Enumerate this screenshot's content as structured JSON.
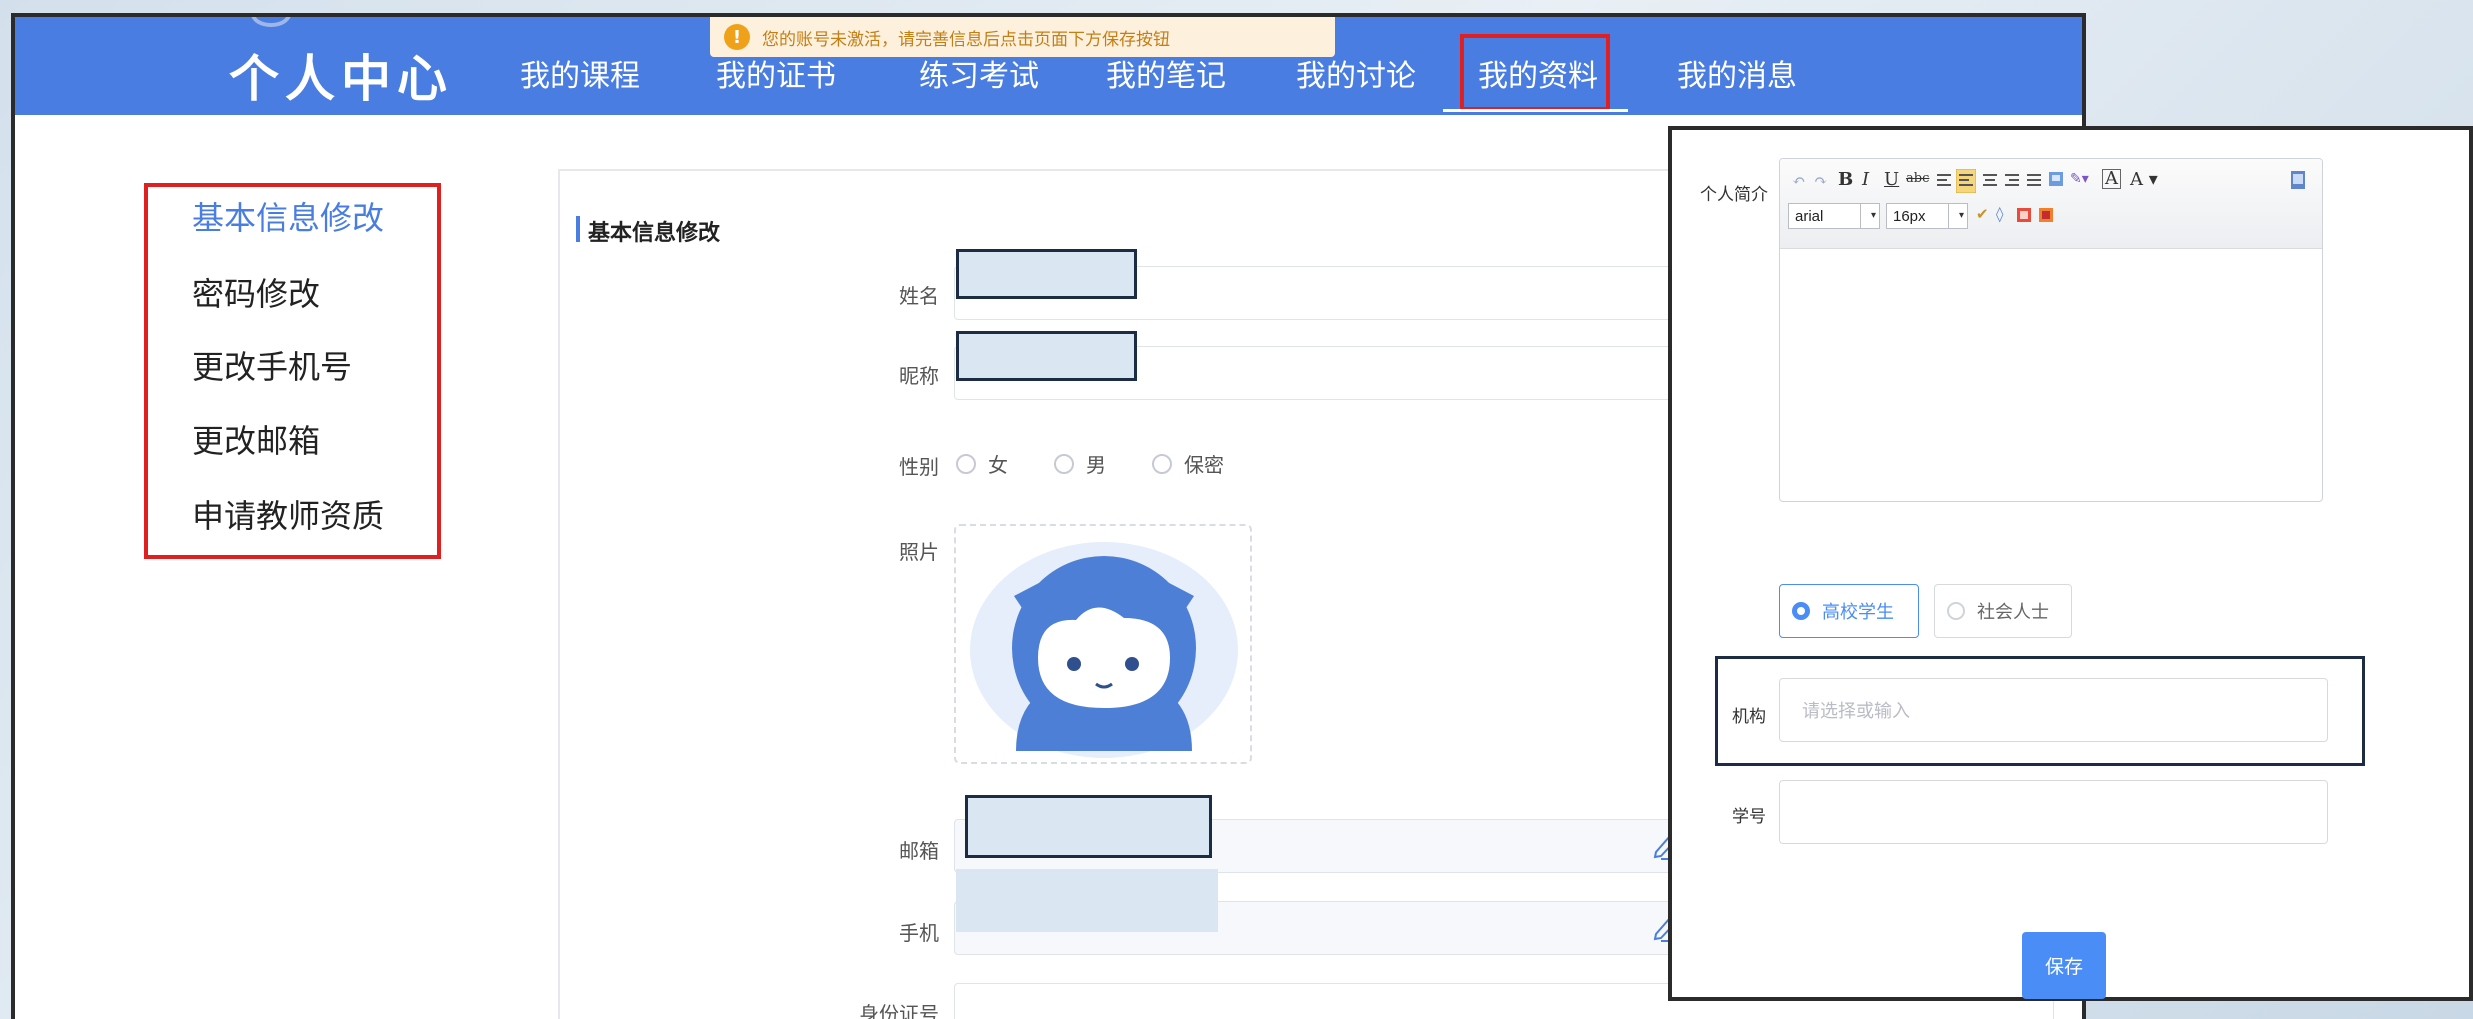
{
  "header": {
    "brand": "个人中心",
    "notice": "您的账号未激活，请完善信息后点击页面下方保存按钮",
    "nav": [
      "我的课程",
      "我的证书",
      "练习考试",
      "我的笔记",
      "我的讨论",
      "我的资料",
      "我的消息"
    ],
    "active_nav": "我的资料"
  },
  "sidebar": {
    "items": [
      "基本信息修改",
      "密码修改",
      "更改手机号",
      "更改邮箱",
      "申请教师资质"
    ],
    "active_item": "基本信息修改"
  },
  "form": {
    "title": "基本信息修改",
    "labels": {
      "name": "姓名",
      "nickname": "昵称",
      "gender": "性别",
      "photo": "照片",
      "email": "邮箱",
      "phone": "手机",
      "id_number": "身份证号"
    },
    "gender_options": [
      "女",
      "男",
      "保密"
    ]
  },
  "overlay": {
    "intro_label": "个人简介",
    "toolbar": {
      "font_family": "arial",
      "font_size": "16px",
      "bold": "B",
      "italic": "I",
      "underline": "U",
      "font_color": "A",
      "highlight": "A"
    },
    "identity_options": [
      "高校学生",
      "社会人士"
    ],
    "selected_identity": "高校学生",
    "org_label": "机构",
    "org_placeholder": "请选择或输入",
    "student_id_label": "学号",
    "save_label": "保存"
  },
  "colors": {
    "nav_bg": "#4a7de2",
    "accent": "#4a8df6",
    "highlight_border": "#e02020",
    "notice_bg": "#fdf1dd",
    "notice_text": "#c47e16"
  }
}
